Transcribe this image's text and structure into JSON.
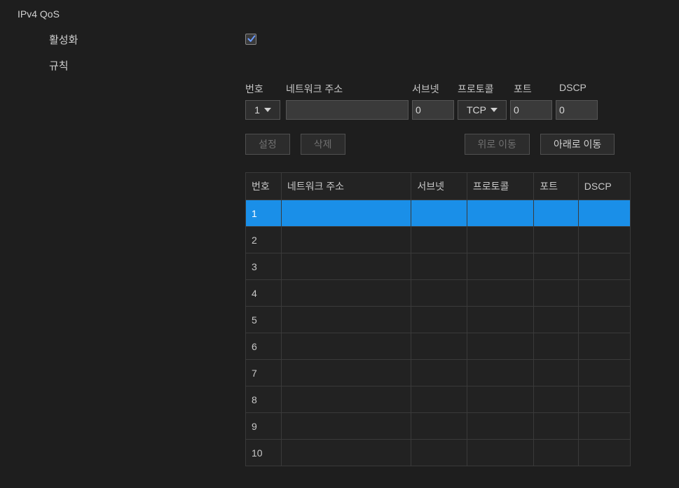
{
  "header": {
    "title": "IPv4 QoS"
  },
  "form": {
    "enable_label": "활성화",
    "rule_label": "규칙",
    "enable_checked": true
  },
  "columns": {
    "no": "번호",
    "network": "네트워크 주소",
    "subnet": "서브넷",
    "protocol": "프로토콜",
    "port": "포트",
    "dscp": "DSCP"
  },
  "inputs": {
    "no_selected": "1",
    "network_value": "",
    "subnet_value": "0",
    "protocol_selected": "TCP",
    "port_value": "0",
    "dscp_value": "0"
  },
  "buttons": {
    "set": "설정",
    "delete": "삭제",
    "move_up": "위로 이동",
    "move_down": "아래로 이동"
  },
  "table": {
    "selected_index": 0,
    "rows": [
      {
        "no": "1",
        "network": "",
        "subnet": "",
        "protocol": "",
        "port": "",
        "dscp": ""
      },
      {
        "no": "2",
        "network": "",
        "subnet": "",
        "protocol": "",
        "port": "",
        "dscp": ""
      },
      {
        "no": "3",
        "network": "",
        "subnet": "",
        "protocol": "",
        "port": "",
        "dscp": ""
      },
      {
        "no": "4",
        "network": "",
        "subnet": "",
        "protocol": "",
        "port": "",
        "dscp": ""
      },
      {
        "no": "5",
        "network": "",
        "subnet": "",
        "protocol": "",
        "port": "",
        "dscp": ""
      },
      {
        "no": "6",
        "network": "",
        "subnet": "",
        "protocol": "",
        "port": "",
        "dscp": ""
      },
      {
        "no": "7",
        "network": "",
        "subnet": "",
        "protocol": "",
        "port": "",
        "dscp": ""
      },
      {
        "no": "8",
        "network": "",
        "subnet": "",
        "protocol": "",
        "port": "",
        "dscp": ""
      },
      {
        "no": "9",
        "network": "",
        "subnet": "",
        "protocol": "",
        "port": "",
        "dscp": ""
      },
      {
        "no": "10",
        "network": "",
        "subnet": "",
        "protocol": "",
        "port": "",
        "dscp": ""
      }
    ]
  }
}
